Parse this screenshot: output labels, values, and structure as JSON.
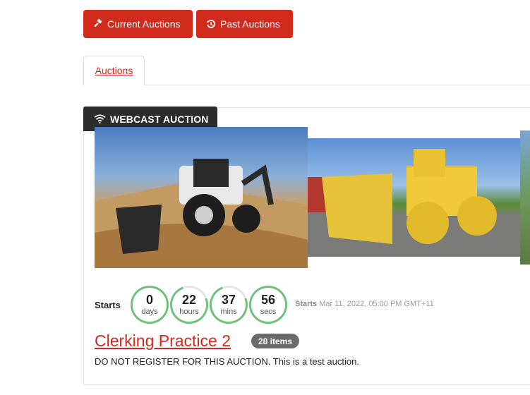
{
  "nav": {
    "current_label": "Current Auctions",
    "past_label": "Past Auctions"
  },
  "tabs": [
    {
      "label": "Auctions",
      "active": true
    }
  ],
  "auction": {
    "badge": "WEBCAST AUCTION",
    "images": [
      {
        "name": "backhoe-loader"
      },
      {
        "name": "yellow-compactor"
      },
      {
        "name": "partial-equipment"
      }
    ],
    "countdown": {
      "starts_label": "Starts",
      "days": {
        "value": "0",
        "unit": "days"
      },
      "hours": {
        "value": "22",
        "unit": "hours"
      },
      "mins": {
        "value": "37",
        "unit": "mins"
      },
      "secs": {
        "value": "56",
        "unit": "secs"
      }
    },
    "starts_info": {
      "label": "Starts",
      "datetime": "Mar 11, 2022, 05:00 PM GMT+11"
    },
    "title": "Clerking Practice 2",
    "items_badge": "28 items",
    "description": "DO NOT REGISTER FOR THIS AUCTION. This is a test auction."
  },
  "colors": {
    "brand_red": "#d32a1e",
    "ring_green": "#6ec27a",
    "badge_dark": "#2b2b2b"
  }
}
